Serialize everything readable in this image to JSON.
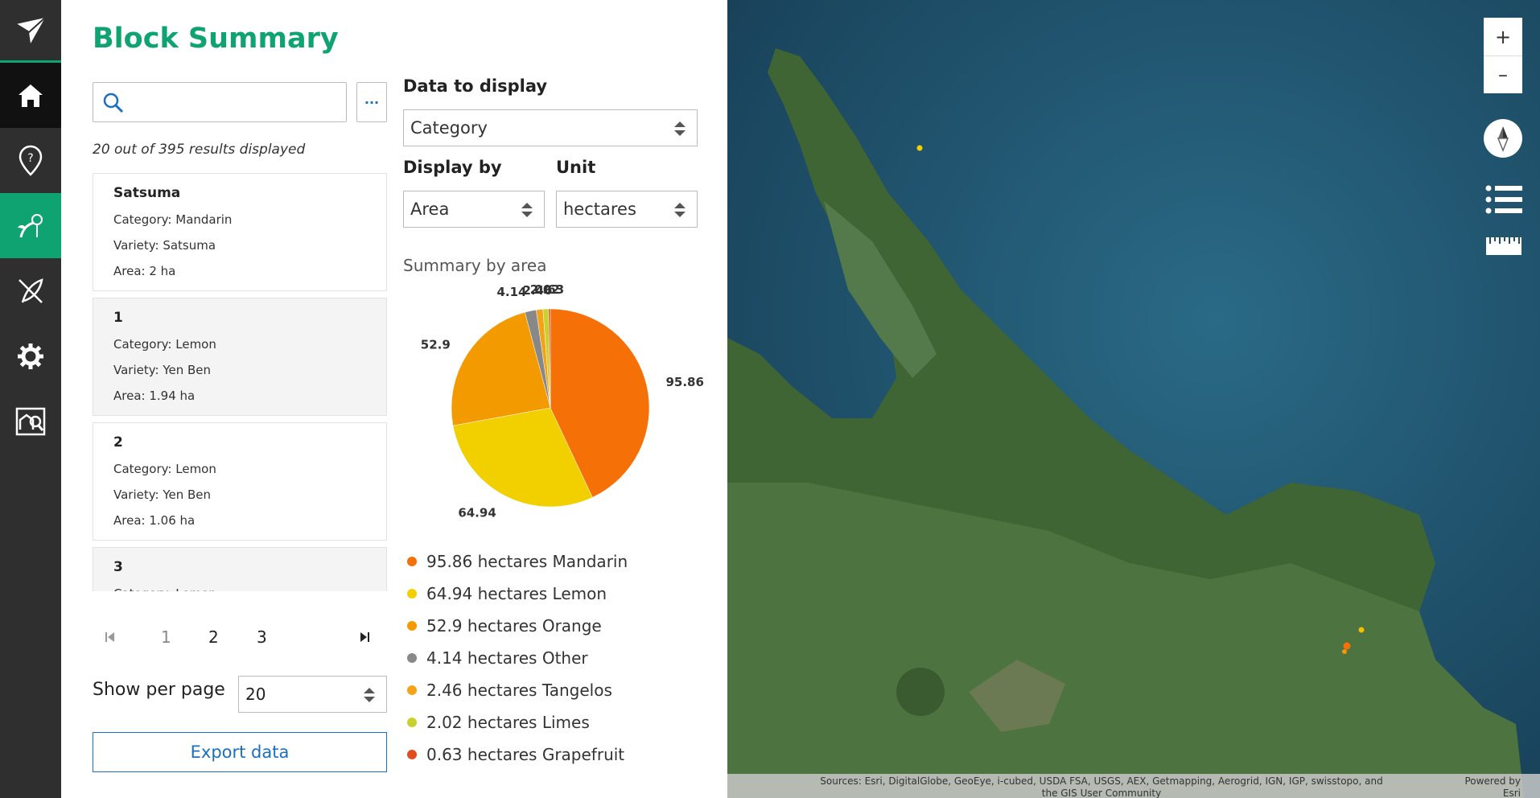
{
  "panel": {
    "title": "Block Summary",
    "search": {
      "value": "",
      "placeholder": ""
    },
    "more_label": "···",
    "results_text": "20 out of 395 results displayed",
    "blocks": [
      {
        "name": "Satsuma",
        "category": "Category: Mandarin",
        "variety": "Variety: Satsuma",
        "area": "Area: 2 ha"
      },
      {
        "name": "1",
        "category": "Category: Lemon",
        "variety": "Variety: Yen Ben",
        "area": "Area: 1.94 ha"
      },
      {
        "name": "2",
        "category": "Category: Lemon",
        "variety": "Variety: Yen Ben",
        "area": "Area: 1.06 ha"
      },
      {
        "name": "3",
        "category": "Category: Lemon",
        "variety": "",
        "area": ""
      }
    ],
    "pagination": {
      "pages": [
        "1",
        "2",
        "3"
      ],
      "current": "1"
    },
    "per_page": {
      "label": "Show per page",
      "value": "20"
    },
    "export_label": "Export data"
  },
  "controls": {
    "data_to_display": {
      "label": "Data to display",
      "value": "Category"
    },
    "display_by": {
      "label": "Display by",
      "value": "Area"
    },
    "unit": {
      "label": "Unit",
      "value": "hectares"
    }
  },
  "summary_title": "Summary by area",
  "chart_data": {
    "type": "pie",
    "categories": [
      "Mandarin",
      "Lemon",
      "Orange",
      "Other",
      "Tangelos",
      "Limes",
      "Grapefruit"
    ],
    "values": [
      95.86,
      64.94,
      52.9,
      4.14,
      2.46,
      2.02,
      0.63
    ],
    "labels": [
      "95.86",
      "64.94",
      "52.9",
      "4.14",
      "2.46",
      "2.02",
      "0.63"
    ],
    "colors": [
      "#f57006",
      "#f2d000",
      "#f29a00",
      "#888888",
      "#f3a31a",
      "#c9d12c",
      "#e04d1f"
    ],
    "legend": [
      "95.86 hectares Mandarin",
      "64.94 hectares Lemon",
      "52.9 hectares Orange",
      "4.14 hectares Other",
      "2.46 hectares Tangelos",
      "2.02 hectares Limes",
      "0.63 hectares Grapefruit"
    ]
  },
  "map": {
    "zoom_in": "+",
    "zoom_out": "–",
    "attribution": "Sources: Esri, DigitalGlobe, GeoEye, i-cubed, USDA FSA, USGS, AEX, Getmapping, Aerogrid, IGN, IGP, swisstopo, and the GIS User Community",
    "powered_by": "Powered by Esri"
  }
}
